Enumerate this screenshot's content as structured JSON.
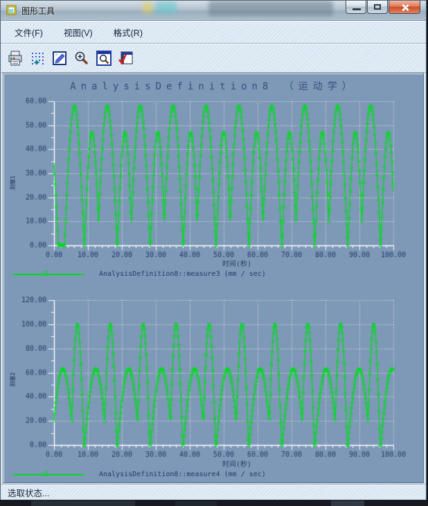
{
  "window": {
    "title": "图形工具",
    "controls": {
      "minimize_icon": "minimize-icon",
      "maximize_icon": "maximize-icon",
      "close_icon": "close-icon"
    }
  },
  "menu": {
    "items": [
      {
        "label": "文件(F)"
      },
      {
        "label": "视图(V)"
      },
      {
        "label": "格式(R)"
      }
    ]
  },
  "toolbar": {
    "icons": [
      "print-icon",
      "point-display-icon",
      "edit-plot-icon",
      "zoom-in-icon",
      "refit-view-icon",
      "export-check-icon"
    ]
  },
  "statusbar": {
    "text": "选取状态..."
  },
  "colors": {
    "canvas_bg": "#7e98b8",
    "curve": "#00dc1e",
    "grid": "#f2eedd",
    "axis": "#ffffff",
    "tick_text": "#283c66",
    "title_text": "#3c4c7e"
  },
  "chart_data": [
    {
      "type": "line",
      "title": "AnalysisDefinition8 （运动学）",
      "xlabel": "时间(秒)",
      "ylabel": "测量1",
      "legend": "AnalysisDefinition8::measure3 (mm / sec)",
      "xlim": [
        0,
        100
      ],
      "ylim": [
        0,
        60
      ],
      "x_ticks": [
        0,
        10,
        20,
        30,
        40,
        50,
        60,
        70,
        80,
        90,
        100
      ],
      "y_ticks": [
        0,
        10,
        20,
        30,
        40,
        50,
        60
      ],
      "x_minor_step": 2,
      "y_minor_step": 5,
      "tick_decimals": 2,
      "grid": "dotted",
      "legend_position": "bottom-left",
      "marker": "hollow-diamond",
      "waveform": {
        "model": "half-cosine-humps [center,peak,halfwidth]; value=max over humps of peak*cos(pi*|t-c|/(2*hw))",
        "marker_step": 0.18,
        "humps": [
          [
            -1.6,
            52,
            2.9
          ],
          [
            6.0,
            58,
            2.9
          ],
          [
            11.2,
            47,
            2.2
          ],
          [
            15.7,
            58,
            2.9
          ],
          [
            20.9,
            47,
            2.2
          ],
          [
            25.4,
            58,
            2.9
          ],
          [
            30.6,
            47,
            2.2
          ],
          [
            35.1,
            58,
            2.9
          ],
          [
            40.3,
            47,
            2.2
          ],
          [
            44.8,
            58,
            2.9
          ],
          [
            50.0,
            47,
            2.2
          ],
          [
            54.5,
            58,
            2.9
          ],
          [
            59.7,
            47,
            2.2
          ],
          [
            64.2,
            58,
            2.9
          ],
          [
            69.4,
            47,
            2.2
          ],
          [
            73.9,
            58,
            2.9
          ],
          [
            79.1,
            47,
            2.2
          ],
          [
            83.6,
            58,
            2.9
          ],
          [
            88.8,
            47,
            2.2
          ],
          [
            93.3,
            58,
            2.9
          ],
          [
            98.5,
            47,
            2.2
          ]
        ]
      }
    },
    {
      "type": "line",
      "title": "",
      "xlabel": "时间(秒)",
      "ylabel": "测量2",
      "legend": "AnalysisDefinition8::measure4 (mm / sec)",
      "xlim": [
        0,
        100
      ],
      "ylim": [
        0,
        120
      ],
      "x_ticks": [
        0,
        10,
        20,
        30,
        40,
        50,
        60,
        70,
        80,
        90,
        100
      ],
      "y_ticks": [
        0,
        20,
        40,
        60,
        80,
        100,
        120
      ],
      "x_minor_step": 2,
      "y_minor_step": 10,
      "tick_decimals": 2,
      "grid": "dotted",
      "legend_position": "bottom-left",
      "marker": "hollow-diamond",
      "waveform": {
        "model": "half-cosine-humps [center,peak,halfwidth]; value=max over humps of peak*cos(pi*|t-c|/(2*hw))",
        "marker_step": 0.18,
        "humps": [
          [
            2.6,
            63,
            3.3
          ],
          [
            6.9,
            100,
            1.9
          ],
          [
            12.3,
            63,
            3.3
          ],
          [
            16.6,
            100,
            1.9
          ],
          [
            22.0,
            63,
            3.3
          ],
          [
            26.3,
            100,
            1.9
          ],
          [
            31.7,
            63,
            3.3
          ],
          [
            36.0,
            100,
            1.9
          ],
          [
            41.4,
            63,
            3.3
          ],
          [
            45.7,
            100,
            1.9
          ],
          [
            51.1,
            63,
            3.3
          ],
          [
            55.4,
            100,
            1.9
          ],
          [
            60.8,
            63,
            3.3
          ],
          [
            65.1,
            100,
            1.9
          ],
          [
            70.5,
            63,
            3.3
          ],
          [
            74.8,
            100,
            1.9
          ],
          [
            80.2,
            63,
            3.3
          ],
          [
            84.5,
            100,
            1.9
          ],
          [
            89.9,
            63,
            3.3
          ],
          [
            94.2,
            100,
            1.9
          ],
          [
            99.6,
            63,
            3.3
          ]
        ]
      }
    }
  ]
}
